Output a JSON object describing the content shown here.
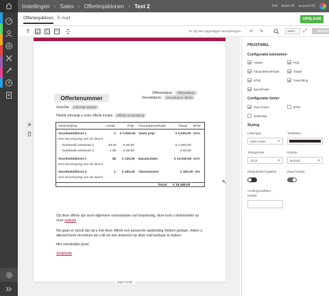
{
  "topbar": {
    "crumbs": [
      "Instellingen",
      "Sales",
      "Offertesjablonen",
      "Test 2"
    ],
    "right_items": [
      "14d",
      "dylan 05",
      "account 02"
    ]
  },
  "tabs": [
    "Offertesjabloon",
    "E-mail"
  ],
  "save_label": "OPSLAAN",
  "toolbar": {
    "unsaved": "Er zijn niet opgeslagen veranderingen",
    "zoom": "100%",
    "edit_label": "BEWERKEN"
  },
  "doc": {
    "title": "Offertenummer",
    "offerdate_label": "Offertedatum:",
    "offerdate_chip": "Offertedatum",
    "expiry_label": "Vervaldatum:",
    "expiry_chip": "Vervaldatum offerte",
    "greeting": "Geachte",
    "greeting_chip": "Informele aanhef",
    "intro": "Hierbij ontvangt u onze offerte inzake",
    "intro_chip": "Offerte omschrijving",
    "table": {
      "headers": [
        "Omschrijving",
        "Aantal",
        "Prijs",
        "Facturatiemethode",
        "Totaal",
        "BTW"
      ],
      "rows": [
        {
          "desc": "Voorbeelddienst 1",
          "qty": "3",
          "price": "€ 2.500,00",
          "method": "Vaste prijs",
          "total": "€ 5.000,00",
          "vat": "21%",
          "bold": true
        },
        {
          "desc": "Een beschrijving van de dienst",
          "italic": true
        },
        {
          "desc": "Voorbeeld urensoort 1",
          "qty": "20.00",
          "price": "€ 80,00",
          "method": "",
          "total": "€ 1.600,00",
          "vat": "",
          "indent": true
        },
        {
          "desc": "Voorbeeld urensoort 2",
          "qty": "1.00",
          "price": "€ 80,00",
          "method": "",
          "total": "€ 80,00",
          "vat": "",
          "indent": true
        },
        {
          "desc": "Voorbeelddienst 2",
          "qty": "80",
          "price": "€ 125,00",
          "method": "Nacalculatie",
          "total": "€ 10.000,00",
          "vat": "21%",
          "bold": true
        },
        {
          "desc": "Een beschrijving van de dienst",
          "italic": true
        },
        {
          "desc": "Voorbeelddienst 3",
          "qty": "1",
          "price": "€ 300,00",
          "method": "Abonnement",
          "total": "€ 300,00",
          "vat": "6%",
          "bold": true
        },
        {
          "desc": "Een beschrijving van de dienst",
          "italic": true
        }
      ],
      "total_label": "Totaal",
      "total_value": "€ 18.468,00"
    },
    "para1_a": "Op deze offerte zijn onze algemene voorwaarden van toepassing, deze kunt u downloaden op",
    "para1_b_prefix": "onze",
    "para1_link": "website",
    "para2_a": "We gaan er vanuit dat wij u met deze offerte een passende aanbieding hebben gedaan. Indien u",
    "para2_b": "akkoord bent verzoeken wij u dit via een antwoord op deze mail kenbaar te maken.",
    "closing": "Met vriendelijke groet,",
    "signature": "Simplicate",
    "pagebreak": "page break"
  },
  "panel": {
    "title": "PRIJSTABEL",
    "columns_heading": "Configuratie kolommen",
    "columns": [
      {
        "label": "Aantal",
        "checked": true
      },
      {
        "label": "Prijs",
        "checked": true
      },
      {
        "label": "Facturatiemethode",
        "checked": true
      },
      {
        "label": "Totaal",
        "checked": true
      },
      {
        "label": "BTW",
        "checked": true
      },
      {
        "label": "Toelichting",
        "checked": true
      },
      {
        "label": "Specificatie",
        "checked": true
      }
    ],
    "footer_heading": "Configuratie footer",
    "footer": [
      {
        "label": "Toon footer",
        "checked": true
      },
      {
        "label": "BTW",
        "checked": false
      },
      {
        "label": "Subtotaal",
        "checked": false
      }
    ],
    "styling_heading": "Styling",
    "font_label": "Lettertype",
    "font_value": "Open Sans",
    "color_label": "Tekstkleur",
    "text_color": "#2d2226",
    "size_label": "Tekstgrootte",
    "size_value": "10 pt",
    "weight_label": "Ruimte",
    "weight_value": "Normal",
    "bold_header_label": "Dikgedrukte koptekst",
    "rand_header_label": "Rand header",
    "bg_header_label_1": "Achtergrondkleur",
    "bg_header_label_2": "header"
  },
  "colors": {
    "accent": "#a8174a",
    "save": "#54b34a"
  }
}
